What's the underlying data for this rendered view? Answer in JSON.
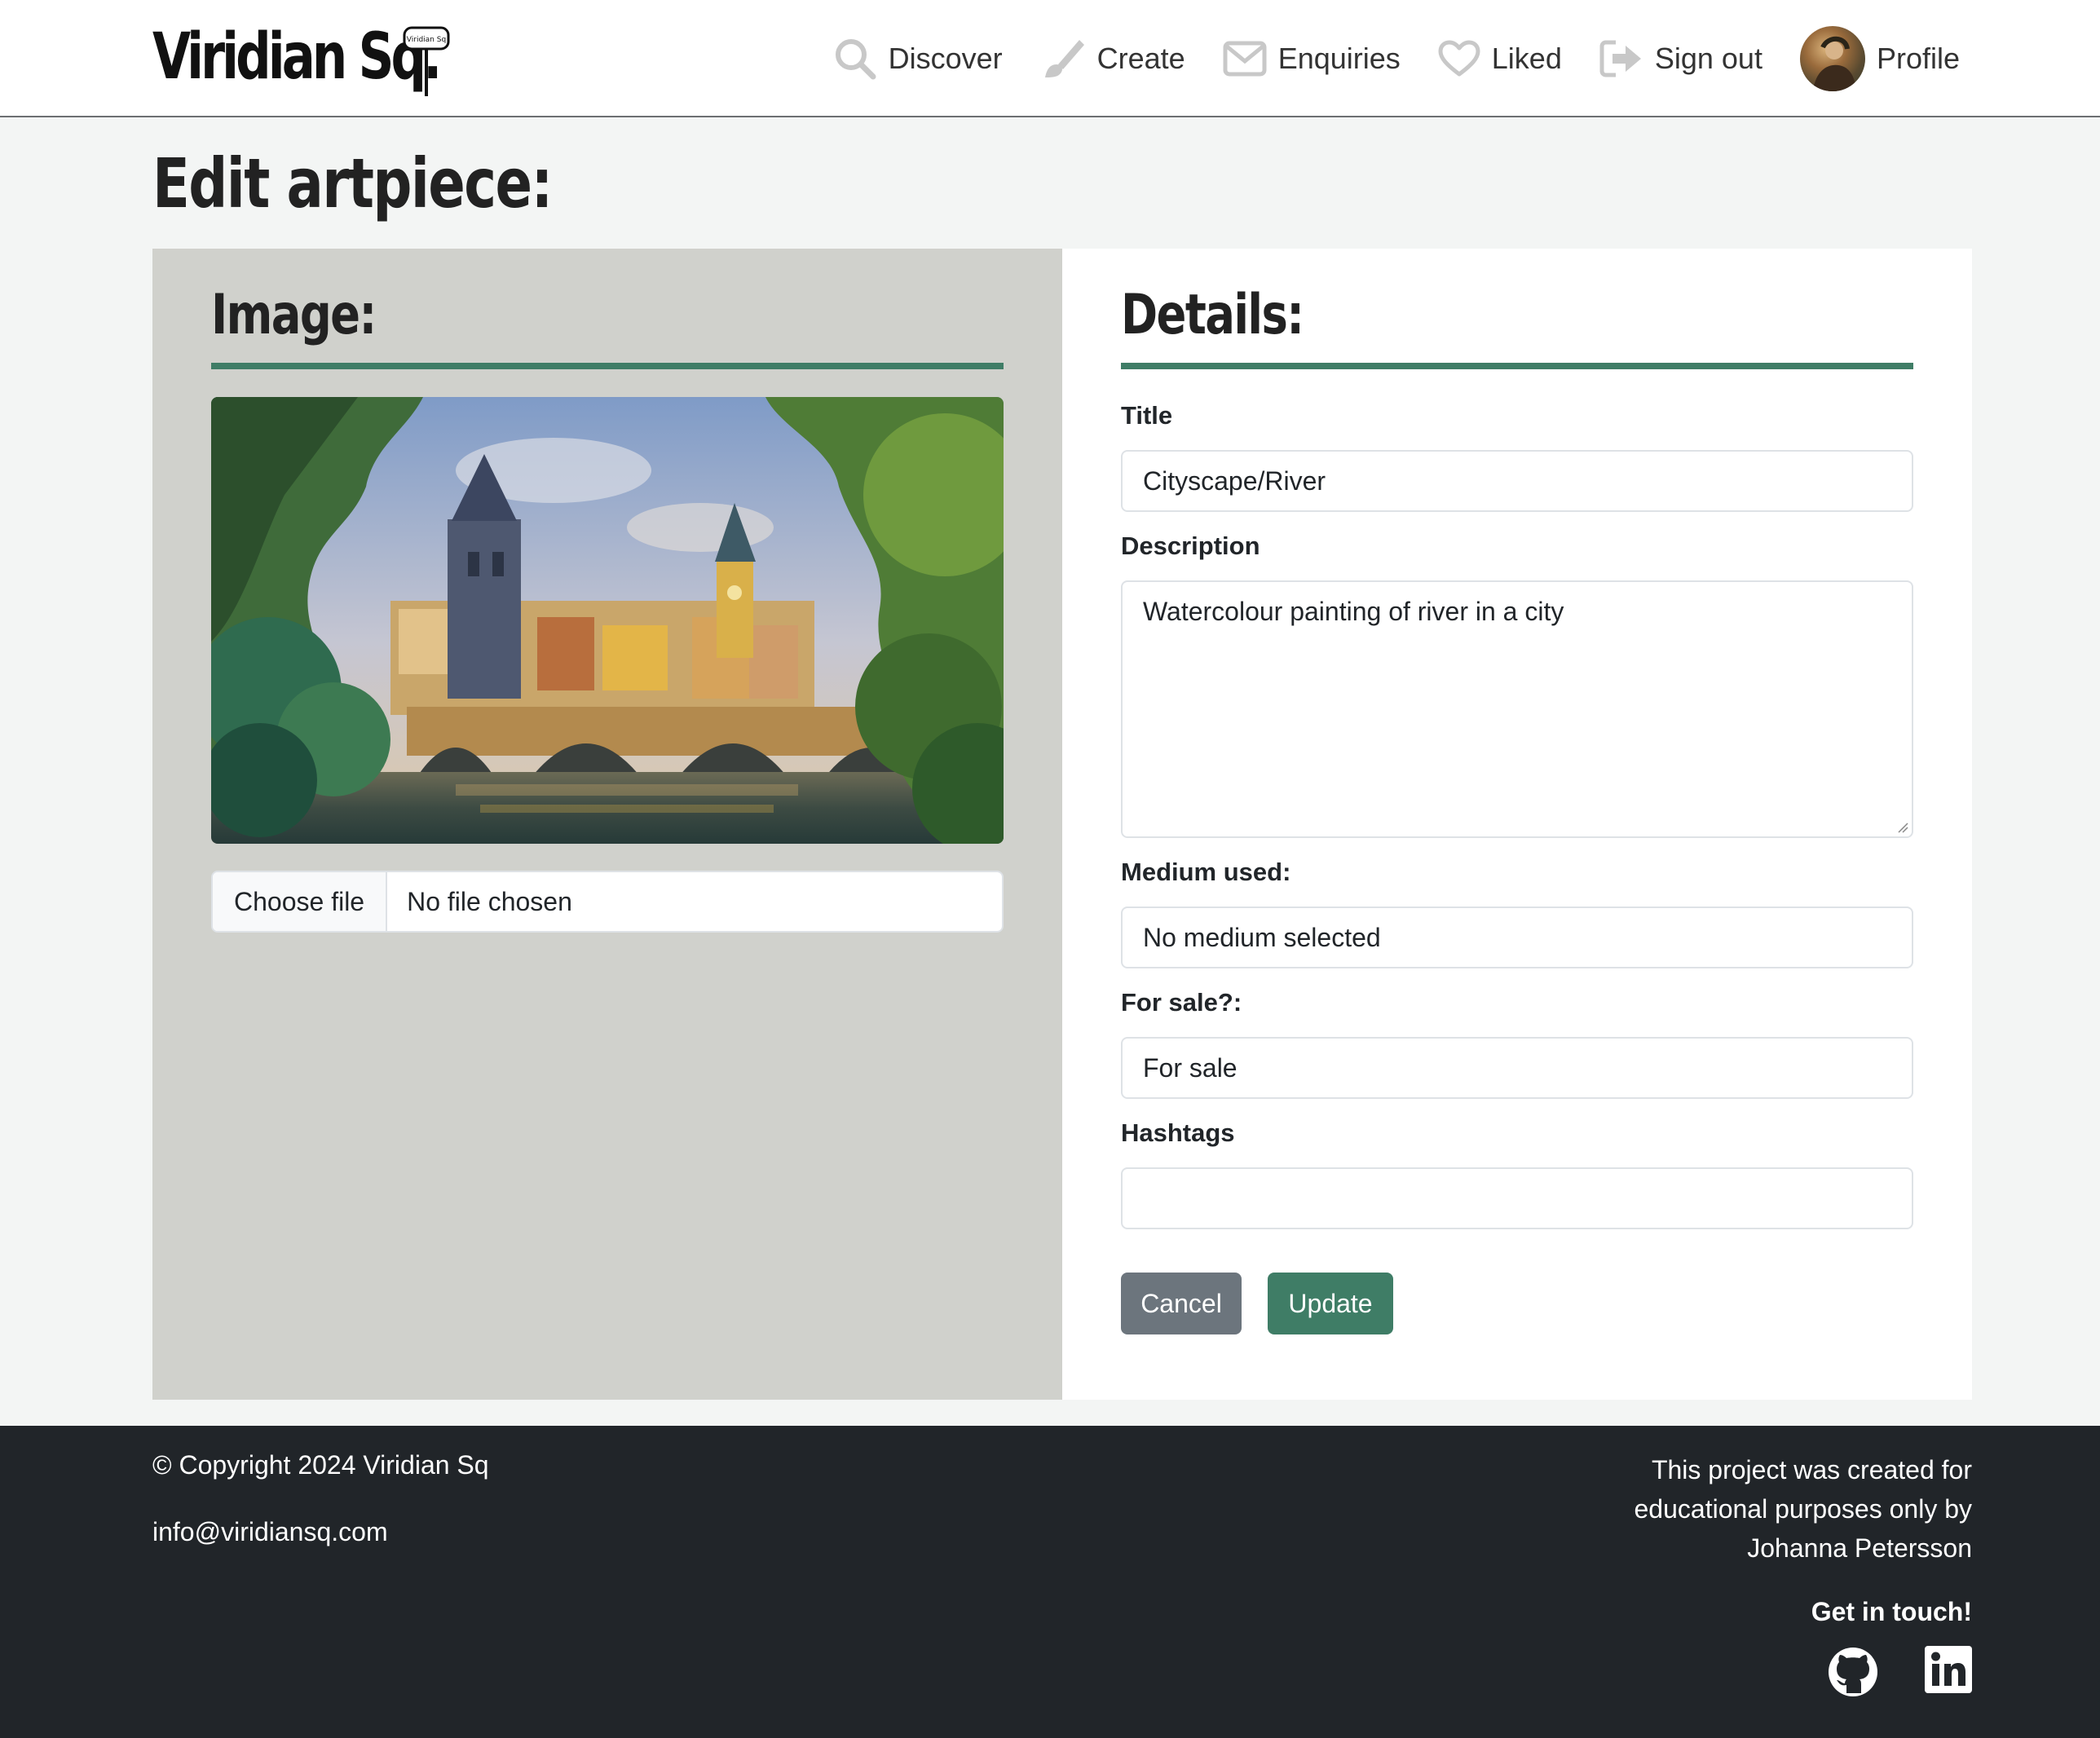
{
  "brand": {
    "name": "Viridian Sq.",
    "sign_text": "Viridian Sq"
  },
  "nav": {
    "items": [
      {
        "label": "Discover",
        "icon": "search-icon"
      },
      {
        "label": "Create",
        "icon": "paintbrush-icon"
      },
      {
        "label": "Enquiries",
        "icon": "envelope-icon"
      },
      {
        "label": "Liked",
        "icon": "heart-icon"
      },
      {
        "label": "Sign out",
        "icon": "sign-out-icon"
      },
      {
        "label": "Profile",
        "icon": "avatar"
      }
    ]
  },
  "page": {
    "title": "Edit artpiece:"
  },
  "image_panel": {
    "heading": "Image:",
    "file_button": "Choose file",
    "file_status": "No file chosen"
  },
  "details": {
    "heading": "Details:",
    "title_label": "Title",
    "title_value": "Cityscape/River",
    "description_label": "Description",
    "description_value": "Watercolour painting of river in a city",
    "medium_label": "Medium used:",
    "medium_value": "No medium selected",
    "sale_label": "For sale?:",
    "sale_value": "For sale",
    "hashtags_label": "Hashtags",
    "hashtags_value": "",
    "cancel_label": "Cancel",
    "update_label": "Update"
  },
  "footer": {
    "copyright": "© Copyright 2024 Viridian Sq",
    "email": "info@viridiansq.com",
    "note": "This project was created for educational purposes only by Johanna Petersson",
    "get_in_touch": "Get in touch!",
    "social": [
      "github-icon",
      "linkedin-icon"
    ]
  },
  "colors": {
    "accent": "#3f7d66",
    "footer_bg": "#212529",
    "left_panel_bg": "#d0d1cc",
    "page_bg": "#f3f5f4",
    "cancel_bg": "#6c757d"
  }
}
